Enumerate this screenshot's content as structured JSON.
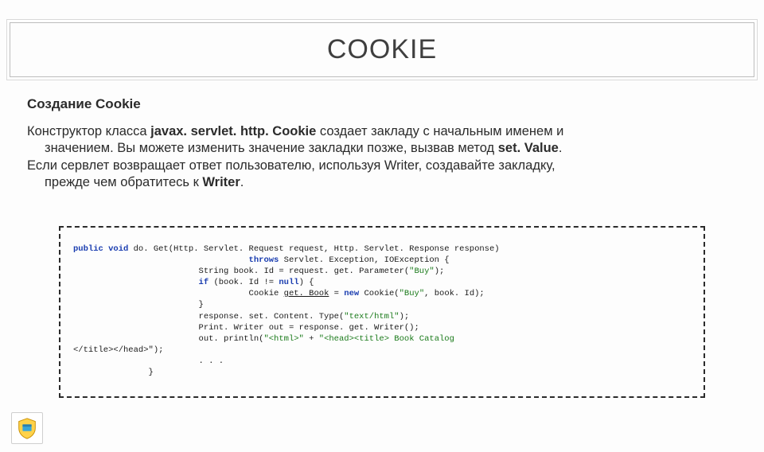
{
  "title": "COOKIE",
  "subheading": "Создание Cookie",
  "para1_a": "Конструктор класса ",
  "para1_b": "javax. servlet. http. Cookie",
  "para1_c": " создает закладу с начальным именем и",
  "para1_indent_a": "значением. Вы можете изменить значение закладки позже, вызвав метод ",
  "para1_indent_b": "set. Value",
  "para1_indent_c": ".",
  "para2_a": "Если сервлет возвращает ответ пользователю, используя Writer, создавайте закладку,",
  "para2_indent_a": "прежде чем обратитесь к ",
  "para2_indent_b": "Writer",
  "para2_indent_c": ".",
  "code": {
    "l1a": "public void",
    "l1b": " do. Get(Http. Servlet. Request request, Http. Servlet. Response response)",
    "l2a": "                                   throws",
    "l2b": " Servlet. Exception, IOException {",
    "l3a": "                         String book. Id = request. get. Parameter(",
    "l3b": "\"Buy\"",
    "l3c": ");",
    "l4a": "                         if",
    "l4b": " (book. Id != ",
    "l4c": "null",
    "l4d": ") {",
    "l5a": "                                   Cookie ",
    "l5b": "get. Book",
    "l5c": " = ",
    "l5d": "new",
    "l5e": " Cookie(",
    "l5f": "\"Buy\"",
    "l5g": ", book. Id);",
    "l6": "                         }",
    "l7a": "                         response. set. Content. Type(",
    "l7b": "\"text/html\"",
    "l7c": ");",
    "l8": "                         Print. Writer out = response. get. Writer();",
    "l9a": "                         out. println(",
    "l9b": "\"<html>\"",
    "l9c": " + ",
    "l9d": "\"<head><title> Book Catalog",
    "l10": "</title></head>\");",
    "l11": "                         . . .",
    "l12": "               }"
  }
}
